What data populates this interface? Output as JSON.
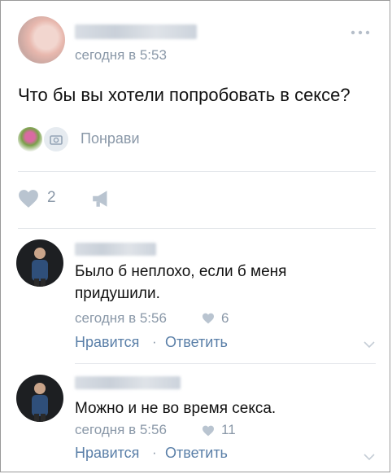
{
  "post": {
    "time": "сегодня в 5:53",
    "text": "Что бы вы хотели попробовать в сексе?",
    "attachment_label": "Понрави",
    "likes": "2"
  },
  "comments": [
    {
      "text_line1": "Было б неплохо, если б меня",
      "text_line2": "придушили.",
      "time": "сегодня в 5:56",
      "likes": "6",
      "like_action": "Нравится",
      "reply_action": "Ответить"
    },
    {
      "text_line1": "Можно и не во время секса.",
      "time": "сегодня в 5:56",
      "likes": "11",
      "like_action": "Нравится",
      "reply_action": "Ответить"
    }
  ],
  "icons": [
    "more-dots-icon",
    "heart-icon",
    "share-megaphone-icon",
    "camera-icon",
    "chevron-down-icon"
  ],
  "colors": {
    "link": "#5a7fa8",
    "meta": "#8a98a8",
    "separator": "#e3e6ea"
  }
}
